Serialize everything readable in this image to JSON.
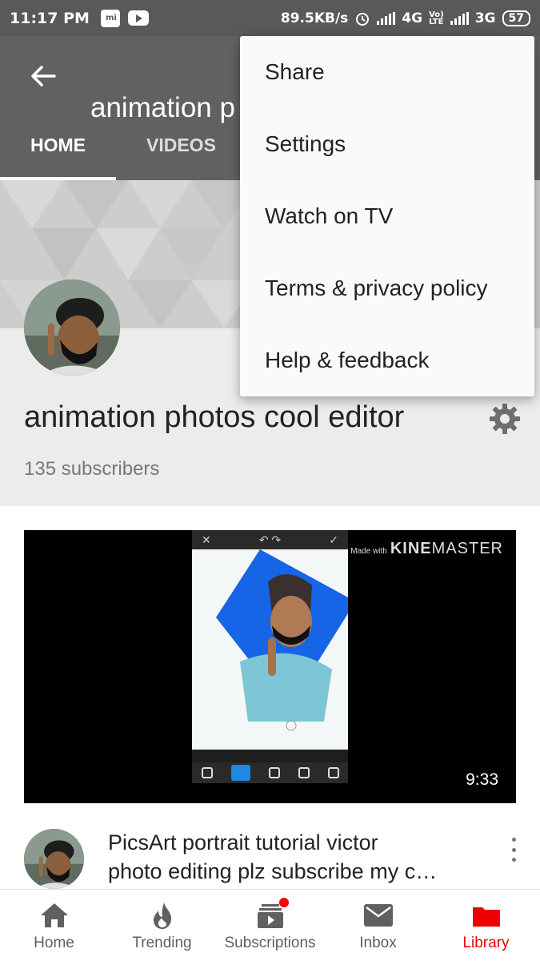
{
  "status_bar": {
    "time": "11:17 PM",
    "speed": "89.5KB/s",
    "net1": "4G",
    "net2": "3G",
    "battery": "57"
  },
  "app_bar": {
    "title": "animation p"
  },
  "tabs": [
    {
      "label": "HOME",
      "active": true
    },
    {
      "label": "VIDEOS",
      "active": false
    }
  ],
  "channel": {
    "name": "animation photos cool editor",
    "subscribers": "135 subscribers"
  },
  "menu": {
    "items": [
      {
        "label": "Share"
      },
      {
        "label": "Settings"
      },
      {
        "label": "Watch on TV"
      },
      {
        "label": "Terms & privacy policy"
      },
      {
        "label": "Help & feedback"
      }
    ]
  },
  "video": {
    "watermark_small": "Made with",
    "watermark_bold": "KINE",
    "watermark_rest": "MASTER",
    "duration": "9:33",
    "title_line1": "PicsArt portrait tutorial victor",
    "title_line2": "photo editing plz subscribe my c…"
  },
  "bottom_nav": {
    "items": [
      {
        "label": "Home",
        "icon": "home-icon"
      },
      {
        "label": "Trending",
        "icon": "trending-icon"
      },
      {
        "label": "Subscriptions",
        "icon": "subscriptions-icon"
      },
      {
        "label": "Inbox",
        "icon": "inbox-icon"
      },
      {
        "label": "Library",
        "icon": "library-icon",
        "active": true
      }
    ]
  },
  "colors": {
    "app_bar": "#616161",
    "active_nav": "#ee0000",
    "accent_blue": "#1e88e5"
  }
}
